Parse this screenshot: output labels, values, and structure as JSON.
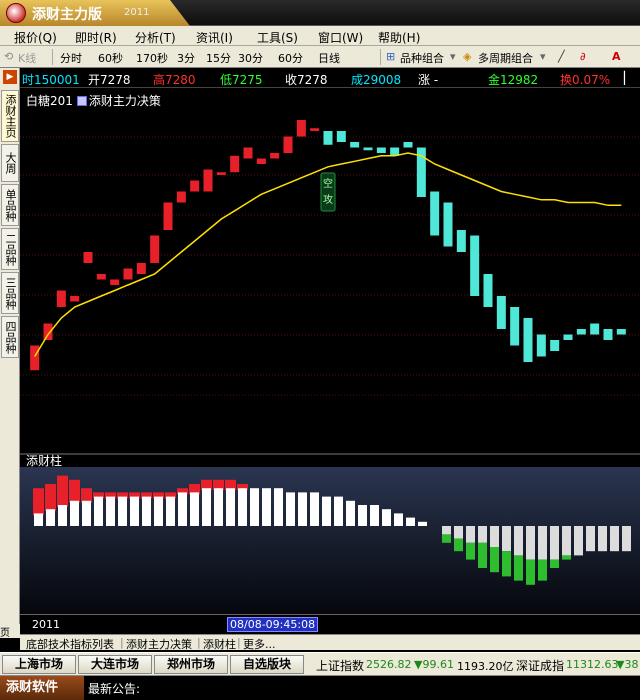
{
  "app": {
    "title": "添财主力版",
    "year": "2011"
  },
  "menu": [
    "报价(Q)",
    "即时(R)",
    "分析(T)",
    "资讯(I)",
    "工具(S)",
    "窗口(W)",
    "帮助(H)"
  ],
  "toolbar": {
    "kline": "K线",
    "periods": [
      "分时",
      "60秒",
      "170秒",
      "3分",
      "15分",
      "30分",
      "60分",
      "日线"
    ],
    "combo1": "品种组合",
    "combo2": "多周期组合"
  },
  "sidebar": {
    "tabs": [
      "添财主页",
      "大周期",
      "单品种",
      "二品种",
      "三品种",
      "四品种"
    ],
    "page_button": "页"
  },
  "quote": {
    "time": "时150001",
    "open": "开7278",
    "high": "高7280",
    "low": "低7275",
    "close": "收7278",
    "volume": "成29008",
    "change": "涨 -",
    "amount": "金12982",
    "turnover": "换0.07%"
  },
  "chart": {
    "instrument_label": "白糖201",
    "indicator_label": "添财主力决策",
    "sub_label": "添财柱",
    "signal_text": "空攻",
    "year_label": "2011",
    "cursor_time": "08/08-09:45:08"
  },
  "bottom_tabs": [
    "底部技术指标列表",
    "添财主力决策",
    "添财柱",
    "更多..."
  ],
  "markets": [
    "上海市场",
    "大连市场",
    "郑州市场",
    "自选版块"
  ],
  "indices": {
    "sh_label": "上证指数",
    "sh_value": "2526.82",
    "sh_change": "▼99.61",
    "sh_amount": "1193.20亿",
    "sz_label": "深证成指",
    "sz_value": "11312.63",
    "sz_change": "▼38"
  },
  "status": {
    "brand": "添财软件",
    "announcement": "最新公告:"
  },
  "colors": {
    "up": "#e8202a",
    "down": "#4fe8d8",
    "ma": "#ffe000",
    "sub_up": "#ffffff",
    "sub_down": "#2ebd2e"
  },
  "chart_data": {
    "type": "candlestick",
    "candles": [
      {
        "o": 85,
        "h": 66,
        "l": 100,
        "c": 94,
        "d": "up"
      },
      {
        "o": 96,
        "h": 78,
        "l": 118,
        "c": 102,
        "d": "up"
      },
      {
        "o": 108,
        "h": 85,
        "l": 122,
        "c": 114,
        "d": "up"
      },
      {
        "o": 112,
        "h": 104,
        "l": 128,
        "c": 110,
        "d": "up"
      },
      {
        "o": 128,
        "h": 104,
        "l": 132,
        "c": 124,
        "d": "up"
      },
      {
        "o": 120,
        "h": 110,
        "l": 125,
        "c": 118,
        "d": "up"
      },
      {
        "o": 116,
        "h": 114,
        "l": 120,
        "c": 118,
        "d": "up"
      },
      {
        "o": 118,
        "h": 112,
        "l": 124,
        "c": 122,
        "d": "up"
      },
      {
        "o": 120,
        "h": 118,
        "l": 126,
        "c": 124,
        "d": "up"
      },
      {
        "o": 124,
        "h": 120,
        "l": 138,
        "c": 134,
        "d": "up"
      },
      {
        "o": 136,
        "h": 130,
        "l": 150,
        "c": 146,
        "d": "up"
      },
      {
        "o": 146,
        "h": 138,
        "l": 162,
        "c": 150,
        "d": "up"
      },
      {
        "o": 150,
        "h": 145,
        "l": 158,
        "c": 154,
        "d": "up"
      },
      {
        "o": 150,
        "h": 146,
        "l": 162,
        "c": 158,
        "d": "up"
      },
      {
        "o": 156,
        "h": 152,
        "l": 160,
        "c": 157,
        "d": "up"
      },
      {
        "o": 157,
        "h": 154,
        "l": 166,
        "c": 163,
        "d": "up"
      },
      {
        "o": 162,
        "h": 158,
        "l": 168,
        "c": 166,
        "d": "up"
      },
      {
        "o": 160,
        "h": 158,
        "l": 166,
        "c": 162,
        "d": "up"
      },
      {
        "o": 162,
        "h": 158,
        "l": 166,
        "c": 164,
        "d": "up"
      },
      {
        "o": 164,
        "h": 160,
        "l": 172,
        "c": 170,
        "d": "up"
      },
      {
        "o": 170,
        "h": 166,
        "l": 178,
        "c": 176,
        "d": "up"
      },
      {
        "o": 172,
        "h": 168,
        "l": 174,
        "c": 173,
        "d": "up"
      },
      {
        "o": 172,
        "h": 166,
        "l": 172,
        "c": 167,
        "d": "down"
      },
      {
        "o": 172,
        "h": 166,
        "l": 174,
        "c": 168,
        "d": "down"
      },
      {
        "o": 168,
        "h": 164,
        "l": 170,
        "c": 166,
        "d": "down"
      },
      {
        "o": 166,
        "h": 164,
        "l": 168,
        "c": 165,
        "d": "down"
      },
      {
        "o": 166,
        "h": 162,
        "l": 168,
        "c": 164,
        "d": "down"
      },
      {
        "o": 166,
        "h": 162,
        "l": 170,
        "c": 163,
        "d": "down"
      },
      {
        "o": 168,
        "h": 164,
        "l": 170,
        "c": 166,
        "d": "down"
      },
      {
        "o": 166,
        "h": 140,
        "l": 166,
        "c": 148,
        "d": "down"
      },
      {
        "o": 150,
        "h": 126,
        "l": 150,
        "c": 134,
        "d": "down"
      },
      {
        "o": 146,
        "h": 128,
        "l": 146,
        "c": 130,
        "d": "down"
      },
      {
        "o": 136,
        "h": 124,
        "l": 140,
        "c": 128,
        "d": "down"
      },
      {
        "o": 134,
        "h": 108,
        "l": 138,
        "c": 112,
        "d": "down"
      },
      {
        "o": 120,
        "h": 106,
        "l": 124,
        "c": 108,
        "d": "down"
      },
      {
        "o": 112,
        "h": 96,
        "l": 116,
        "c": 100,
        "d": "down"
      },
      {
        "o": 108,
        "h": 92,
        "l": 110,
        "c": 94,
        "d": "down"
      },
      {
        "o": 104,
        "h": 84,
        "l": 108,
        "c": 88,
        "d": "down"
      },
      {
        "o": 98,
        "h": 82,
        "l": 104,
        "c": 90,
        "d": "down"
      },
      {
        "o": 96,
        "h": 90,
        "l": 100,
        "c": 92,
        "d": "down"
      },
      {
        "o": 98,
        "h": 92,
        "l": 108,
        "c": 96,
        "d": "down"
      },
      {
        "o": 100,
        "h": 94,
        "l": 112,
        "c": 98,
        "d": "down"
      },
      {
        "o": 102,
        "h": 96,
        "l": 108,
        "c": 98,
        "d": "down"
      },
      {
        "o": 100,
        "h": 94,
        "l": 104,
        "c": 96,
        "d": "down"
      },
      {
        "o": 100,
        "h": 96,
        "l": 104,
        "c": 98,
        "d": "down"
      }
    ],
    "ma": [
      90,
      98,
      104,
      108,
      110,
      112,
      114,
      116,
      118,
      120,
      124,
      128,
      132,
      136,
      140,
      143,
      146,
      149,
      151,
      153,
      155,
      157,
      159,
      160,
      161,
      162,
      163,
      163,
      164,
      163,
      160,
      158,
      156,
      154,
      152,
      150,
      149,
      148,
      147,
      147,
      146,
      146,
      146,
      145,
      145
    ],
    "bars": [
      {
        "v": 3,
        "e": 9
      },
      {
        "v": 4,
        "e": 10
      },
      {
        "v": 5,
        "e": 12
      },
      {
        "v": 6,
        "e": 11
      },
      {
        "v": 6,
        "e": 9
      },
      {
        "v": 7,
        "e": 8
      },
      {
        "v": 7,
        "e": 8
      },
      {
        "v": 7,
        "e": 8
      },
      {
        "v": 7,
        "e": 8
      },
      {
        "v": 7,
        "e": 8
      },
      {
        "v": 7,
        "e": 8
      },
      {
        "v": 7,
        "e": 8
      },
      {
        "v": 8,
        "e": 9
      },
      {
        "v": 8,
        "e": 10
      },
      {
        "v": 9,
        "e": 11
      },
      {
        "v": 9,
        "e": 11
      },
      {
        "v": 9,
        "e": 11
      },
      {
        "v": 9,
        "e": 10
      },
      {
        "v": 9,
        "e": 9
      },
      {
        "v": 9,
        "e": 9
      },
      {
        "v": 9,
        "e": 9
      },
      {
        "v": 8,
        "e": 8
      },
      {
        "v": 8,
        "e": 8
      },
      {
        "v": 8,
        "e": 8
      },
      {
        "v": 7,
        "e": 7
      },
      {
        "v": 7,
        "e": 7
      },
      {
        "v": 6,
        "e": 6
      },
      {
        "v": 5,
        "e": 5
      },
      {
        "v": 5,
        "e": 5
      },
      {
        "v": 4,
        "e": 4
      },
      {
        "v": 3,
        "e": 3
      },
      {
        "v": 2,
        "e": 2
      },
      {
        "v": 1,
        "e": 1
      },
      {
        "v": 0,
        "e": 0
      },
      {
        "v": -2,
        "e": -4
      },
      {
        "v": -3,
        "e": -6
      },
      {
        "v": -4,
        "e": -8
      },
      {
        "v": -4,
        "e": -10
      },
      {
        "v": -5,
        "e": -11
      },
      {
        "v": -6,
        "e": -12
      },
      {
        "v": -7,
        "e": -13
      },
      {
        "v": -8,
        "e": -14
      },
      {
        "v": -8,
        "e": -13
      },
      {
        "v": -8,
        "e": -10
      },
      {
        "v": -7,
        "e": -8
      },
      {
        "v": -7,
        "e": -7
      },
      {
        "v": -6,
        "e": -6
      },
      {
        "v": -6,
        "e": -6
      },
      {
        "v": -6,
        "e": -6
      },
      {
        "v": -6,
        "e": -6
      }
    ]
  }
}
